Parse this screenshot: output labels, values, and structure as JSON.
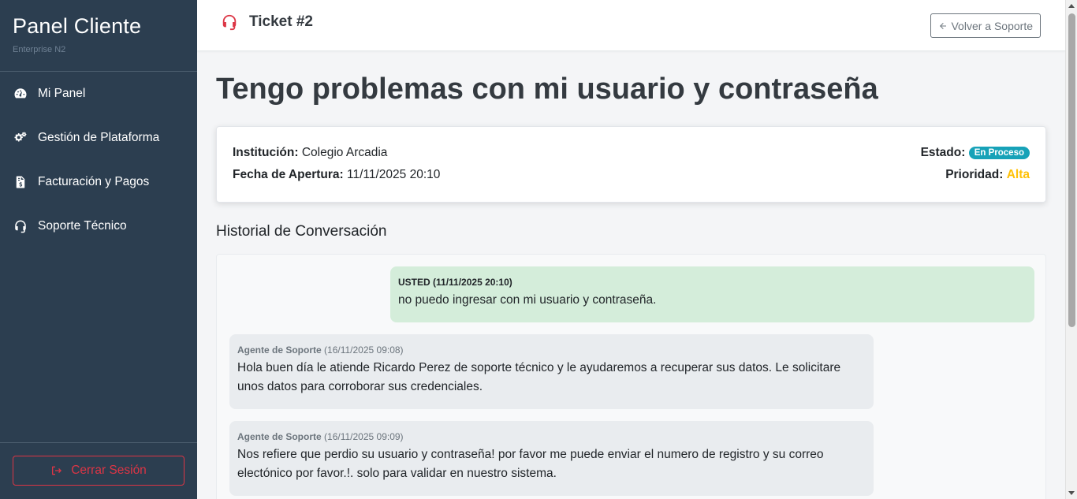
{
  "sidebar": {
    "brand_title": "Panel Cliente",
    "brand_subtitle": "Enterprise N2",
    "items": [
      {
        "label": "Mi Panel",
        "icon": "tachometer-icon"
      },
      {
        "label": "Gestión de Plataforma",
        "icon": "cogs-icon"
      },
      {
        "label": "Facturación y Pagos",
        "icon": "invoice-icon"
      },
      {
        "label": "Soporte Técnico",
        "icon": "headset-icon"
      }
    ],
    "logout_label": "Cerrar Sesión"
  },
  "header": {
    "title": "Ticket #2",
    "back_label": "Volver a Soporte"
  },
  "ticket": {
    "subject": "Tengo problemas con mi usuario y contraseña",
    "institution_label": "Institución:",
    "institution_value": "Colegio Arcadia",
    "opened_label": "Fecha de Apertura:",
    "opened_value": "11/11/2025 20:10",
    "status_label": "Estado:",
    "status_value": "En Proceso",
    "priority_label": "Prioridad:",
    "priority_value": "Alta"
  },
  "history": {
    "title": "Historial de Conversación",
    "messages": [
      {
        "author": "USTED",
        "time": "(11/11/2025 20:10)",
        "text": "no puedo ingresar con mi usuario y contraseña."
      },
      {
        "author": "Agente de Soporte",
        "time": "(16/11/2025 09:08)",
        "text": "Hola buen día le atiende Ricardo Perez de soporte técnico y le ayudaremos a recuperar sus datos. Le solicitare unos datos para corroborar sus credenciales."
      },
      {
        "author": "Agente de Soporte",
        "time": "(16/11/2025 09:09)",
        "text": "Nos refiere que perdio su usuario y contraseña! por favor me puede enviar el numero de registro y su correo electónico por favor.!. solo para validar en nuestro sistema."
      }
    ]
  },
  "colors": {
    "sidebar_bg": "#2c3e50",
    "danger": "#dc3545",
    "status_badge": "#17a2b8",
    "priority_high": "#ffc107",
    "user_bubble": "#d4edda",
    "agent_bubble": "#e9ecef"
  }
}
